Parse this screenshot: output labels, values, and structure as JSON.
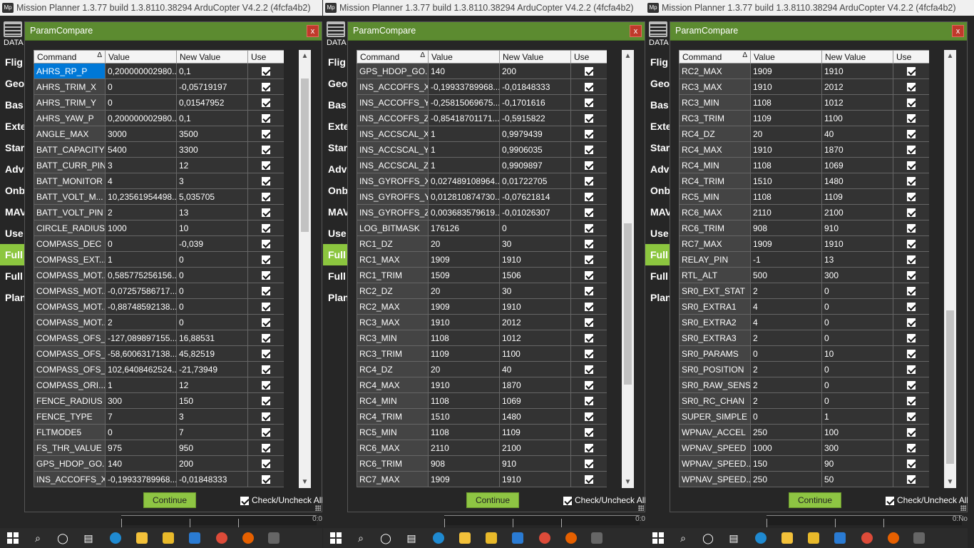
{
  "window_title": "Mission Planner 1.3.77 build 1.3.8110.38294 ArduCopter V4.2.2 (4fcfa4b2)",
  "app_logo": "Mp",
  "background": {
    "data_label": "DATA",
    "menu_items": [
      "Flig",
      "Geo",
      "Bas",
      "Exte",
      "Star",
      "Adv",
      "Onb",
      "MAV",
      "Use",
      "Full",
      "Full",
      "Plan"
    ],
    "active_index": 9
  },
  "dialog": {
    "title": "ParamCompare",
    "close_label": "x",
    "columns": [
      "Command",
      "Value",
      "New Value",
      "Use"
    ],
    "sort_indicator": "Δ",
    "continue_label": "Continue",
    "check_all_label": "Check/Uncheck All"
  },
  "bottom_labels": [
    "0:0",
    "0:0",
    "0:No"
  ],
  "accent_colors": {
    "title_green": "#5c8b30",
    "button_green": "#8ec543",
    "selection_blue": "#0078d7"
  },
  "panes": [
    {
      "selected_row": 0,
      "scroll_thumb": {
        "start": 0.04,
        "end": 0.41
      },
      "rows": [
        [
          "AHRS_RP_P",
          "0,200000002980...",
          "0,1"
        ],
        [
          "AHRS_TRIM_X",
          "0",
          "-0,05719197"
        ],
        [
          "AHRS_TRIM_Y",
          "0",
          "0,01547952"
        ],
        [
          "AHRS_YAW_P",
          "0,200000002980...",
          "0,1"
        ],
        [
          "ANGLE_MAX",
          "3000",
          "3500"
        ],
        [
          "BATT_CAPACITY",
          "5400",
          "3300"
        ],
        [
          "BATT_CURR_PIN",
          "3",
          "12"
        ],
        [
          "BATT_MONITOR",
          "4",
          "3"
        ],
        [
          "BATT_VOLT_M...",
          "10,23561954498...",
          "5,035705"
        ],
        [
          "BATT_VOLT_PIN",
          "2",
          "13"
        ],
        [
          "CIRCLE_RADIUS",
          "1000",
          "10"
        ],
        [
          "COMPASS_DEC",
          "0",
          "-0,039"
        ],
        [
          "COMPASS_EXT...",
          "1",
          "0"
        ],
        [
          "COMPASS_MOT...",
          "0,585775256156...",
          "0"
        ],
        [
          "COMPASS_MOT...",
          "-0,07257586717...",
          "0"
        ],
        [
          "COMPASS_MOT...",
          "-0,88748592138...",
          "0"
        ],
        [
          "COMPASS_MOT...",
          "2",
          "0"
        ],
        [
          "COMPASS_OFS_X",
          "-127,089897155...",
          "16,88531"
        ],
        [
          "COMPASS_OFS_Y",
          "-58,6006317138...",
          "45,82519"
        ],
        [
          "COMPASS_OFS_Z",
          "102,6408462524...",
          "-21,73949"
        ],
        [
          "COMPASS_ORI...",
          "1",
          "12"
        ],
        [
          "FENCE_RADIUS",
          "300",
          "150"
        ],
        [
          "FENCE_TYPE",
          "7",
          "3"
        ],
        [
          "FLTMODE5",
          "0",
          "7"
        ],
        [
          "FS_THR_VALUE",
          "975",
          "950"
        ],
        [
          "GPS_HDOP_GO...",
          "140",
          "200"
        ],
        [
          "INS_ACCOFFS_X",
          "-0,19933789968...",
          "-0,01848333"
        ]
      ]
    },
    {
      "selected_row": -1,
      "scroll_thumb": {
        "start": 0.39,
        "end": 0.78
      },
      "rows": [
        [
          "GPS_HDOP_GO...",
          "140",
          "200"
        ],
        [
          "INS_ACCOFFS_X",
          "-0,19933789968...",
          "-0,01848333"
        ],
        [
          "INS_ACCOFFS_Y",
          "-0,25815069675...",
          "-0,1701616"
        ],
        [
          "INS_ACCOFFS_Z",
          "-0,85418701171...",
          "-0,5915822"
        ],
        [
          "INS_ACCSCAL_X",
          "1",
          "0,9979439"
        ],
        [
          "INS_ACCSCAL_Y",
          "1",
          "0,9906035"
        ],
        [
          "INS_ACCSCAL_Z",
          "1",
          "0,9909897"
        ],
        [
          "INS_GYROFFS_X",
          "0,027489108964...",
          "0,01722705"
        ],
        [
          "INS_GYROFFS_Y",
          "0,012810874730...",
          "-0,07621814"
        ],
        [
          "INS_GYROFFS_Z",
          "0,003683579619...",
          "-0,01026307"
        ],
        [
          "LOG_BITMASK",
          "176126",
          "0"
        ],
        [
          "RC1_DZ",
          "20",
          "30"
        ],
        [
          "RC1_MAX",
          "1909",
          "1910"
        ],
        [
          "RC1_TRIM",
          "1509",
          "1506"
        ],
        [
          "RC2_DZ",
          "20",
          "30"
        ],
        [
          "RC2_MAX",
          "1909",
          "1910"
        ],
        [
          "RC3_MAX",
          "1910",
          "2012"
        ],
        [
          "RC3_MIN",
          "1108",
          "1012"
        ],
        [
          "RC3_TRIM",
          "1109",
          "1100"
        ],
        [
          "RC4_DZ",
          "20",
          "40"
        ],
        [
          "RC4_MAX",
          "1910",
          "1870"
        ],
        [
          "RC4_MIN",
          "1108",
          "1069"
        ],
        [
          "RC4_TRIM",
          "1510",
          "1480"
        ],
        [
          "RC5_MIN",
          "1108",
          "1109"
        ],
        [
          "RC6_MAX",
          "2110",
          "2100"
        ],
        [
          "RC6_TRIM",
          "908",
          "910"
        ],
        [
          "RC7_MAX",
          "1909",
          "1910"
        ]
      ]
    },
    {
      "selected_row": -1,
      "scroll_thumb": {
        "start": 0.6,
        "end": 0.97
      },
      "rows": [
        [
          "RC2_MAX",
          "1909",
          "1910"
        ],
        [
          "RC3_MAX",
          "1910",
          "2012"
        ],
        [
          "RC3_MIN",
          "1108",
          "1012"
        ],
        [
          "RC3_TRIM",
          "1109",
          "1100"
        ],
        [
          "RC4_DZ",
          "20",
          "40"
        ],
        [
          "RC4_MAX",
          "1910",
          "1870"
        ],
        [
          "RC4_MIN",
          "1108",
          "1069"
        ],
        [
          "RC4_TRIM",
          "1510",
          "1480"
        ],
        [
          "RC5_MIN",
          "1108",
          "1109"
        ],
        [
          "RC6_MAX",
          "2110",
          "2100"
        ],
        [
          "RC6_TRIM",
          "908",
          "910"
        ],
        [
          "RC7_MAX",
          "1909",
          "1910"
        ],
        [
          "RELAY_PIN",
          "-1",
          "13"
        ],
        [
          "RTL_ALT",
          "500",
          "300"
        ],
        [
          "SR0_EXT_STAT",
          "2",
          "0"
        ],
        [
          "SR0_EXTRA1",
          "4",
          "0"
        ],
        [
          "SR0_EXTRA2",
          "4",
          "0"
        ],
        [
          "SR0_EXTRA3",
          "2",
          "0"
        ],
        [
          "SR0_PARAMS",
          "0",
          "10"
        ],
        [
          "SR0_POSITION",
          "2",
          "0"
        ],
        [
          "SR0_RAW_SENS",
          "2",
          "0"
        ],
        [
          "SR0_RC_CHAN",
          "2",
          "0"
        ],
        [
          "SUPER_SIMPLE",
          "0",
          "1"
        ],
        [
          "WPNAV_ACCEL",
          "250",
          "100"
        ],
        [
          "WPNAV_SPEED",
          "1000",
          "300"
        ],
        [
          "WPNAV_SPEED...",
          "150",
          "90"
        ],
        [
          "WPNAV_SPEED...",
          "250",
          "50"
        ]
      ]
    }
  ]
}
